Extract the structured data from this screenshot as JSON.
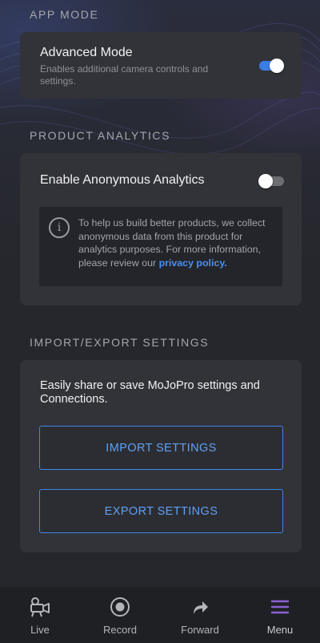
{
  "app_mode": {
    "header": "APP MODE",
    "advanced": {
      "title": "Advanced Mode",
      "description": "Enables additional camera controls and settings.",
      "enabled": true
    }
  },
  "analytics": {
    "header": "PRODUCT ANALYTICS",
    "title": "Enable Anonymous Analytics",
    "enabled": false,
    "info_text": "To help us build better products, we collect anonymous data from this product for analytics purposes. For more information, please review our ",
    "link_text": "privacy policy",
    "info_suffix": "."
  },
  "import_export": {
    "header": "IMPORT/EXPORT SETTINGS",
    "description": "Easily share or save MoJoPro settings and Connections.",
    "import_label": "IMPORT SETTINGS",
    "export_label": "EXPORT SETTINGS"
  },
  "nav": {
    "items": [
      {
        "label": "Live",
        "icon": "camera-icon"
      },
      {
        "label": "Record",
        "icon": "record-icon"
      },
      {
        "label": "Forward",
        "icon": "forward-arrow-icon"
      },
      {
        "label": "Menu",
        "icon": "menu-icon"
      }
    ],
    "active": "Menu"
  },
  "colors": {
    "accent": "#3b7de6",
    "link": "#4a8ef0",
    "menu_active": "#8e5fd6"
  }
}
